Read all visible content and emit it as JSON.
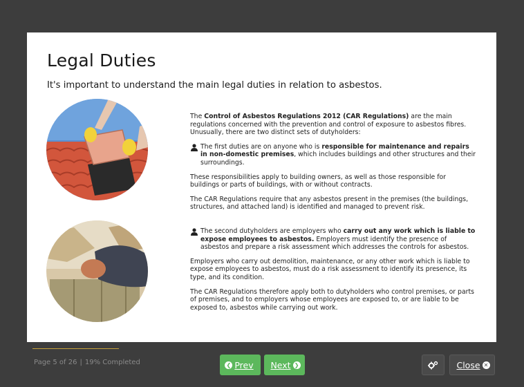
{
  "slide": {
    "title": "Legal Duties",
    "subtitle": "It's important to understand the main legal duties in relation to asbestos.",
    "intro_pre": "The ",
    "intro_bold": "Control of Asbestos Regulations 2012 (CAR Regulations)",
    "intro_post": " are the main regulations concerned with the prevention and control of exposure to asbestos fibres. Unusually, there are two distinct sets of dutyholders:",
    "bullet1_pre": "The first duties are on anyone who is ",
    "bullet1_bold": "responsible for maintenance and repairs in non-domestic premises",
    "bullet1_post": ", which includes buildings and other structures and their surroundings.",
    "para2": "These responsibilities apply to building owners, as well as those responsible for buildings or parts of buildings, with or without contracts.",
    "para3": "The CAR Regulations require that any asbestos present in the premises (the buildings, structures, and attached land) is identified and managed to prevent risk.",
    "bullet2_pre": "The second dutyholders are employers who ",
    "bullet2_bold": "carry out any work which is liable to expose employees to asbestos.",
    "bullet2_post": " Employers must identify the presence of asbestos and prepare a risk assessment which addresses the controls for asbestos.",
    "para4": "Employers who carry out demolition, maintenance, or any other work which is liable to expose employees to asbestos, must do a risk assessment to identify its presence, its type, and its condition.",
    "para5": "The CAR Regulations therefore apply both to dutyholders who control premises, or parts of premises, and to employers whose employees are exposed to, or are liable to be exposed to, asbestos while carrying out work."
  },
  "footer": {
    "page_label": "Page 5 of 26",
    "completed_label": "19% Completed",
    "progress_fraction": 0.19,
    "prev_label": "Prev",
    "next_label": "Next",
    "close_label": "Close"
  },
  "colors": {
    "accent_green": "#5cb85c",
    "progress_gold": "#c8a23a",
    "background": "#3d3d3d"
  },
  "icons": {
    "prev": "chevron-left-circle-icon",
    "next": "chevron-right-circle-icon",
    "settings": "gears-icon",
    "close": "x-circle-icon",
    "bullet": "person-icon"
  }
}
